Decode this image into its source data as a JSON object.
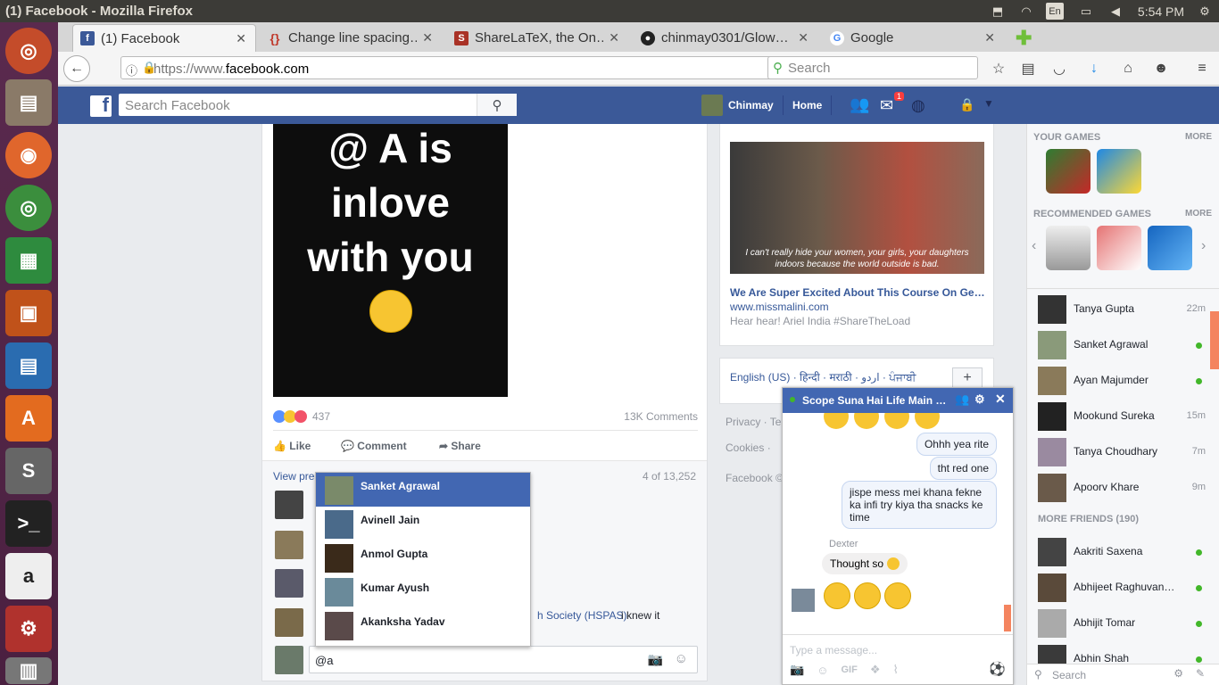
{
  "os": {
    "window_title": "(1) Facebook - Mozilla Firefox",
    "keyboard": "En",
    "clock": "5:54 PM"
  },
  "tabs": [
    {
      "label": "(1) Facebook",
      "icon": "facebook-icon",
      "color": "#3b5998"
    },
    {
      "label": "Change line spacing…",
      "icon": "tex-icon",
      "color": "#c0392b"
    },
    {
      "label": "ShareLaTeX, the On…",
      "icon": "sharelatex-icon",
      "color": "#a93226"
    },
    {
      "label": "chinmay0301/Glow…",
      "icon": "github-icon",
      "color": "#222222"
    },
    {
      "label": "Google",
      "icon": "google-icon",
      "color": "#4285f4"
    }
  ],
  "browser": {
    "url_prefix": "https://www.",
    "url_domain": "facebook.com",
    "search_placeholder": "Search"
  },
  "fb": {
    "search_placeholder": "Search Facebook",
    "user": "Chinmay",
    "home": "Home",
    "notif_count": "1"
  },
  "post": {
    "image_lines": [
      "@ A is",
      "inlove",
      "with you"
    ],
    "reaction_count": "437",
    "comments_count": "13K Comments",
    "like": "Like",
    "comment": "Comment",
    "share": "Share",
    "view_previous": "View pre",
    "pager": "4 of 13,252",
    "comment_text_tail": "h Society (HSPAS)",
    "comment_text_end": "i knew it",
    "input_value": "@a"
  },
  "mentions": [
    {
      "name": "Sanket Agrawal",
      "selected": true
    },
    {
      "name": "Avinell Jain"
    },
    {
      "name": "Anmol Gupta"
    },
    {
      "name": "Kumar Ayush"
    },
    {
      "name": "Akanksha Yadav"
    }
  ],
  "ad": {
    "caption": "I can't really hide your women, your girls, your daughters indoors because the world outside is bad.",
    "title": "We Are Super Excited About This Course On Ge…",
    "site": "www.missmalini.com",
    "desc": "Hear hear! Ariel India #ShareTheLoad"
  },
  "languages": "English (US) · हिन्दी · मराठी · اردو · ਪੰਜਾਬੀ",
  "footer": {
    "privacy": "Privacy · Te",
    "cookies": "Cookies ·",
    "copyright": "Facebook ©"
  },
  "right": {
    "your_games": "YOUR GAMES",
    "more": "MORE",
    "recommended": "RECOMMENDED GAMES",
    "more_friends": "MORE FRIENDS (190)",
    "search_placeholder": "Search",
    "friends": [
      {
        "name": "Tanya Gupta",
        "time": "22m"
      },
      {
        "name": "Sanket Agrawal",
        "online": true
      },
      {
        "name": "Ayan Majumder",
        "online": true
      },
      {
        "name": "Mookund Sureka",
        "time": "15m"
      },
      {
        "name": "Tanya Choudhary",
        "time": "7m"
      },
      {
        "name": "Apoorv Khare",
        "time": "9m"
      }
    ],
    "more_friend_list": [
      {
        "name": "Aakriti Saxena",
        "online": true
      },
      {
        "name": "Abhijeet Raghuvan…",
        "online": true
      },
      {
        "name": "Abhijit Tomar",
        "online": true
      },
      {
        "name": "Abhin Shah",
        "online": true
      }
    ]
  },
  "chat": {
    "title": "Scope Suna Hai Life Main …",
    "messages": [
      "Ohhh yea rite",
      "tht red one",
      "jispe mess mei khana fekne ka infi try kiya tha snacks ke time"
    ],
    "sender": "Dexter",
    "reply": "Thought so",
    "input_placeholder": "Type a message...",
    "gif": "GIF"
  }
}
